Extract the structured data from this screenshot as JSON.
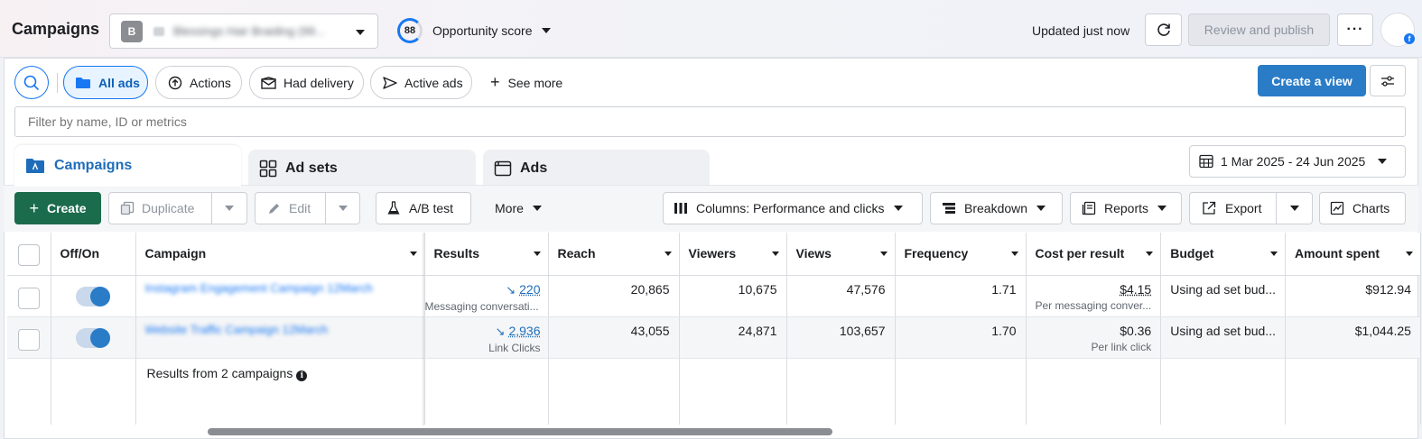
{
  "header": {
    "title": "Campaigns",
    "account_initial": "B",
    "account_name": "Blessings Hair Braiding (99...",
    "opportunity_score": "88",
    "opportunity_label": "Opportunity score",
    "updated": "Updated just now",
    "review_publish": "Review and publish",
    "more": "···",
    "avatar_letter": "f"
  },
  "filters": {
    "all_ads": "All ads",
    "actions": "Actions",
    "had_delivery": "Had delivery",
    "active_ads": "Active ads",
    "see_more": "See more",
    "create_view": "Create a view",
    "filter_placeholder": "Filter by name, ID or metrics"
  },
  "tabs": [
    {
      "label": "Campaigns"
    },
    {
      "label": "Ad sets"
    },
    {
      "label": "Ads"
    }
  ],
  "date_range": "1 Mar 2025 - 24 Jun 2025",
  "toolbar": {
    "create": "Create",
    "duplicate": "Duplicate",
    "edit": "Edit",
    "ab_test": "A/B test",
    "more": "More",
    "columns": "Columns: Performance and clicks",
    "breakdown": "Breakdown",
    "reports": "Reports",
    "export": "Export",
    "charts": "Charts"
  },
  "table": {
    "headers": [
      "Off/On",
      "Campaign",
      "Results",
      "Reach",
      "Viewers",
      "Views",
      "Frequency",
      "Cost per result",
      "Budget",
      "Amount spent"
    ],
    "rows": [
      {
        "campaign": "Instagram Engagement Campaign 12March",
        "results": "220",
        "results_sub": "Messaging conversati...",
        "reach": "20,865",
        "viewers": "10,675",
        "views": "47,576",
        "frequency": "1.71",
        "cost": "$4.15",
        "cost_sub": "Per messaging conver...",
        "budget": "Using ad set bud...",
        "spent": "$912.94"
      },
      {
        "campaign": "Website Traffic Campaign 12March",
        "results": "2,936",
        "results_sub": "Link Clicks",
        "reach": "43,055",
        "viewers": "24,871",
        "views": "103,657",
        "frequency": "1.70",
        "cost": "$0.36",
        "cost_sub": "Per link click",
        "budget": "Using ad set bud...",
        "spent": "$1,044.25"
      }
    ],
    "summary": "Results from 2 campaigns"
  }
}
